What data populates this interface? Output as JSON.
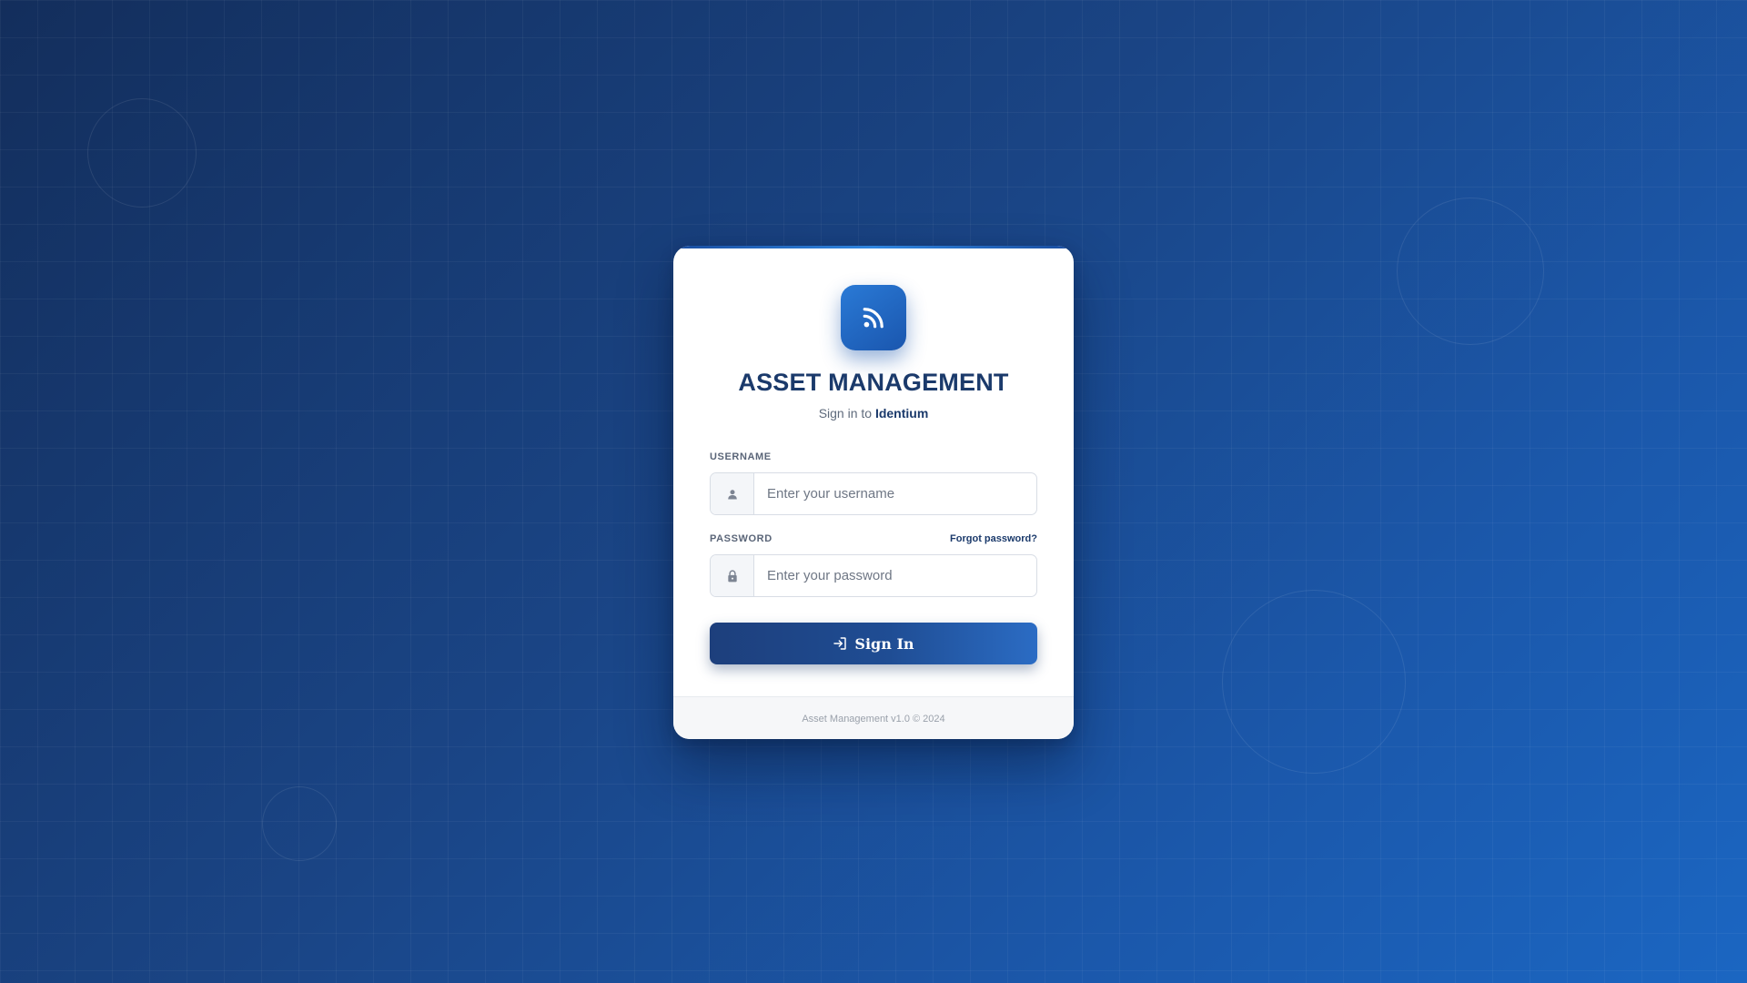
{
  "app": {
    "title": "ASSET MANAGEMENT",
    "subtitle_prefix": "Sign in to",
    "subtitle_brand": "Identium"
  },
  "logo": {
    "icon": "rss-feed-icon",
    "color": "#2a7ad6"
  },
  "form": {
    "username": {
      "label": "USERNAME",
      "placeholder": "Enter your username",
      "value": "",
      "icon": "user-icon"
    },
    "password": {
      "label": "PASSWORD",
      "placeholder": "Enter your password",
      "value": "",
      "icon": "lock-icon",
      "forgot_link": "Forgot password?"
    },
    "submit": {
      "label": "Sign In",
      "icon": "sign-in-icon"
    }
  },
  "footer": {
    "text": "Asset Management v1.0 © 2024"
  },
  "colors": {
    "accent": "#1b3a6b",
    "background_start": "#132e5c",
    "background_end": "#1b66c2",
    "button": "#1f4d94"
  }
}
